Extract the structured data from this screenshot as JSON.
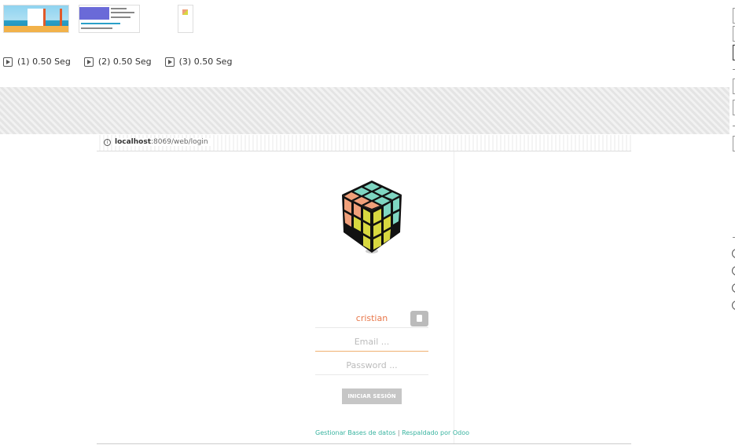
{
  "frames": [
    {
      "label": "(1) 0.50 Seg"
    },
    {
      "label": "(2) 0.50 Seg"
    },
    {
      "label": "(3) 0.50 Seg"
    }
  ],
  "browser": {
    "url_host": "localhost",
    "url_path": ":8069/web/login"
  },
  "login": {
    "database": "cristian",
    "email_placeholder": "Email ...",
    "password_placeholder": "Password ...",
    "submit_label": "INICIAR SESIÓN"
  },
  "footer": {
    "manage_db": "Gestionar Bases de datos",
    "separator": "|",
    "powered_by": "Respaldado por Odoo"
  },
  "colors": {
    "accent_orange": "#e8774a",
    "link_teal": "#39b4a0",
    "cube_front": "#d8d840",
    "cube_left": "#f0a07a",
    "cube_right": "#7fd6c2"
  },
  "icons": [
    "play-icon",
    "info-icon",
    "database-icon",
    "rubiks-cube-logo"
  ]
}
